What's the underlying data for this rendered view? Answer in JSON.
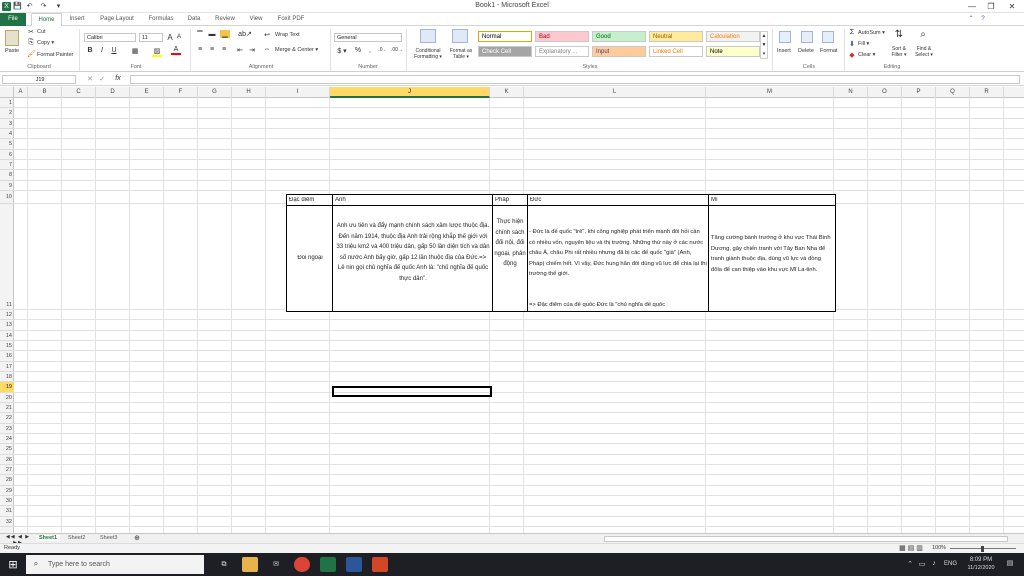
{
  "window": {
    "title": "Book1 - Microsoft Excel"
  },
  "quick_access": {
    "save": "💾",
    "undo": "↶",
    "redo": "↷",
    "more": "▾"
  },
  "window_controls": {
    "minimize": "—",
    "restore": "❐",
    "close": "✕"
  },
  "tabs": [
    "File",
    "Home",
    "Insert",
    "Page Layout",
    "Formulas",
    "Data",
    "Review",
    "View",
    "Foxit PDF"
  ],
  "ribbon": {
    "clipboard": {
      "paste": "Paste",
      "cut": "Cut",
      "copy": "Copy ▾",
      "format_painter": "Format Painter",
      "label": "Clipboard"
    },
    "font": {
      "name": "Calibri",
      "size": "11",
      "bold": "B",
      "italic": "I",
      "underline": "U",
      "label": "Font",
      "grow": "A",
      "shrink": "A"
    },
    "alignment": {
      "wrap_text": "Wrap Text",
      "merge_center": "Merge & Center ▾",
      "label": "Alignment"
    },
    "number": {
      "format": "General",
      "currency": "$ ▾",
      "percent": "%",
      "comma": ",",
      "label": "Number"
    },
    "styles": {
      "conditional": "Conditional Formatting ▾",
      "format_table": "Format as Table ▾",
      "cells": [
        {
          "text": "Normal",
          "bg": "#ffffff",
          "fg": "#000000"
        },
        {
          "text": "Bad",
          "bg": "#ffc7ce",
          "fg": "#9c0006"
        },
        {
          "text": "Good",
          "bg": "#c6efce",
          "fg": "#006100"
        },
        {
          "text": "Neutral",
          "bg": "#ffeb9c",
          "fg": "#9c5700"
        },
        {
          "text": "Calculation",
          "bg": "#f2f2f2",
          "fg": "#fa7d00"
        },
        {
          "text": "Check Cell",
          "bg": "#a5a5a5",
          "fg": "#ffffff"
        },
        {
          "text": "Explanatory ...",
          "bg": "#ffffff",
          "fg": "#7f7f7f"
        },
        {
          "text": "Input",
          "bg": "#ffcc99",
          "fg": "#3f3f76"
        },
        {
          "text": "Linked Cell",
          "bg": "#ffffff",
          "fg": "#fa7d00"
        },
        {
          "text": "Note",
          "bg": "#ffffcc",
          "fg": "#000000"
        }
      ],
      "label": "Styles"
    },
    "cells": {
      "insert": "Insert",
      "delete": "Delete",
      "format": "Format",
      "label": "Cells"
    },
    "editing": {
      "autosum": "AutoSum ▾",
      "fill": "Fill ▾",
      "clear": "Clear ▾",
      "sort_filter": "Sort & Filter ▾",
      "find_select": "Find & Select ▾",
      "label": "Editing"
    }
  },
  "formula_bar": {
    "name_box": "J19",
    "fx": "fx",
    "value": ""
  },
  "columns": [
    {
      "name": "A"
    },
    {
      "name": "B"
    },
    {
      "name": "C"
    },
    {
      "name": "D"
    },
    {
      "name": "E"
    },
    {
      "name": "F"
    },
    {
      "name": "G"
    },
    {
      "name": "H"
    },
    {
      "name": "I"
    },
    {
      "name": "J",
      "selected": true
    },
    {
      "name": "K"
    },
    {
      "name": "L"
    },
    {
      "name": "M"
    },
    {
      "name": "N"
    },
    {
      "name": "O"
    },
    {
      "name": "P"
    },
    {
      "name": "Q"
    },
    {
      "name": "R"
    }
  ],
  "rows": [
    "1",
    "2",
    "3",
    "4",
    "5",
    "6",
    "7",
    "8",
    "9",
    "10",
    "11",
    "12",
    "13",
    "14",
    "15",
    "16",
    "17",
    "18",
    "19",
    "20",
    "21",
    "22",
    "23",
    "24",
    "25",
    "26",
    "27",
    "28",
    "29",
    "30",
    "31",
    "32"
  ],
  "selected_row": "19",
  "table": {
    "header": [
      "Đặc điểm",
      "Anh",
      "Pháp",
      "Đức",
      "Mĩ"
    ],
    "row_label": "Đối ngoại",
    "anh": "Anh ưu tiên và đẩy mạnh chính sách xâm lược thuộc địa. Đến năm 1914, thuộc địa Anh trải rộng khắp thế giới với 33 triệu km2 và 400 triệu dân, gấp 50 lần diện tích và dân số nước Anh bấy giờ, gấp 12 lần thuộc địa của Đức.=> Lê nin gọi chủ nghĩa đế quốc Anh là: \"chủ nghĩa đế quốc thực dân\".",
    "phap": "Thực hiện chính sách đối nội, đối ngoại, phản động",
    "duc_1": "- Đức là đế quốc \"trẻ\", khi công nghiệp phát triển mạnh đòi hỏi cần có nhiều vốn, nguyên liệu và thị trường. Những thứ này ở các nước châu Á, châu Phi rất nhiều nhưng đã bị các đế quốc \"già\" (Anh, Pháp) chiếm hết. Vì vậy, Đức hung hăn đòi dùng vũ lực để chia lại thị trường thế giới.",
    "duc_2": "=> Đặc điểm của đế quốc Đức là \"chủ nghĩa đế quốc",
    "mi": "Tăng cường bành trướng ở khu vực Thái Bình Dương, gây chiến tranh với Tây Ban Nha để tranh giành thuộc địa, dùng vũ lực và đồng đôla để can thiệp vào khu vực Mĩ La-tinh."
  },
  "sheets": [
    "Sheet1",
    "Sheet2",
    "Sheet3"
  ],
  "status": {
    "ready": "Ready",
    "zoom": "100%"
  },
  "taskbar": {
    "search_placeholder": "Type here to search",
    "lang": "ENG",
    "time": "8:09 PM",
    "date": "11/12/2020"
  }
}
